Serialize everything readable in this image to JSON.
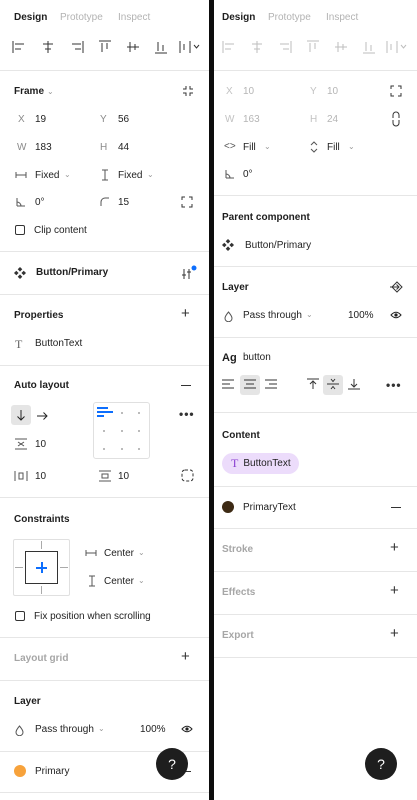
{
  "tabs": [
    "Design",
    "Prototype",
    "Inspect"
  ],
  "left": {
    "frame": {
      "title": "Frame",
      "x_label": "X",
      "x": "19",
      "y_label": "Y",
      "y": "56",
      "w_label": "W",
      "w": "183",
      "h_label": "H",
      "h": "44",
      "width_mode": "Fixed",
      "height_mode": "Fixed",
      "rotation": "0°",
      "radius": "15",
      "clip_content": "Clip content"
    },
    "component": {
      "name": "Button/Primary"
    },
    "properties": {
      "title": "Properties",
      "item": "ButtonText"
    },
    "auto_layout": {
      "title": "Auto layout",
      "spacing": "10",
      "padding_h": "10",
      "padding_v": "10"
    },
    "constraints": {
      "title": "Constraints",
      "horizontal": "Center",
      "vertical": "Center",
      "fix_position": "Fix position when scrolling"
    },
    "layout_grid": {
      "title": "Layout grid"
    },
    "layer": {
      "title": "Layer",
      "blend": "Pass through",
      "opacity": "100%"
    },
    "fill": {
      "name": "Primary",
      "color": "#f7a23b"
    }
  },
  "right": {
    "position": {
      "x_label": "X",
      "x": "10",
      "y_label": "Y",
      "y": "10",
      "w_label": "W",
      "w": "163",
      "h_label": "H",
      "h": "24",
      "width_mode": "Fill",
      "height_mode": "Fill",
      "rotation": "0°"
    },
    "parent_component": {
      "title": "Parent component",
      "name": "Button/Primary"
    },
    "layer": {
      "title": "Layer",
      "blend": "Pass through",
      "opacity": "100%"
    },
    "text": {
      "style_prefix": "Ag",
      "style_name": "button"
    },
    "content": {
      "title": "Content",
      "prop": "ButtonText"
    },
    "fill": {
      "name": "PrimaryText",
      "color": "#3d2a14"
    },
    "stroke": {
      "title": "Stroke"
    },
    "effects": {
      "title": "Effects"
    },
    "export": {
      "title": "Export"
    }
  },
  "help_label": "?",
  "colors": {
    "accent": "#0d6efd",
    "content_pill": "#ecdcfb",
    "selected_bg": "#e5e5e5"
  }
}
